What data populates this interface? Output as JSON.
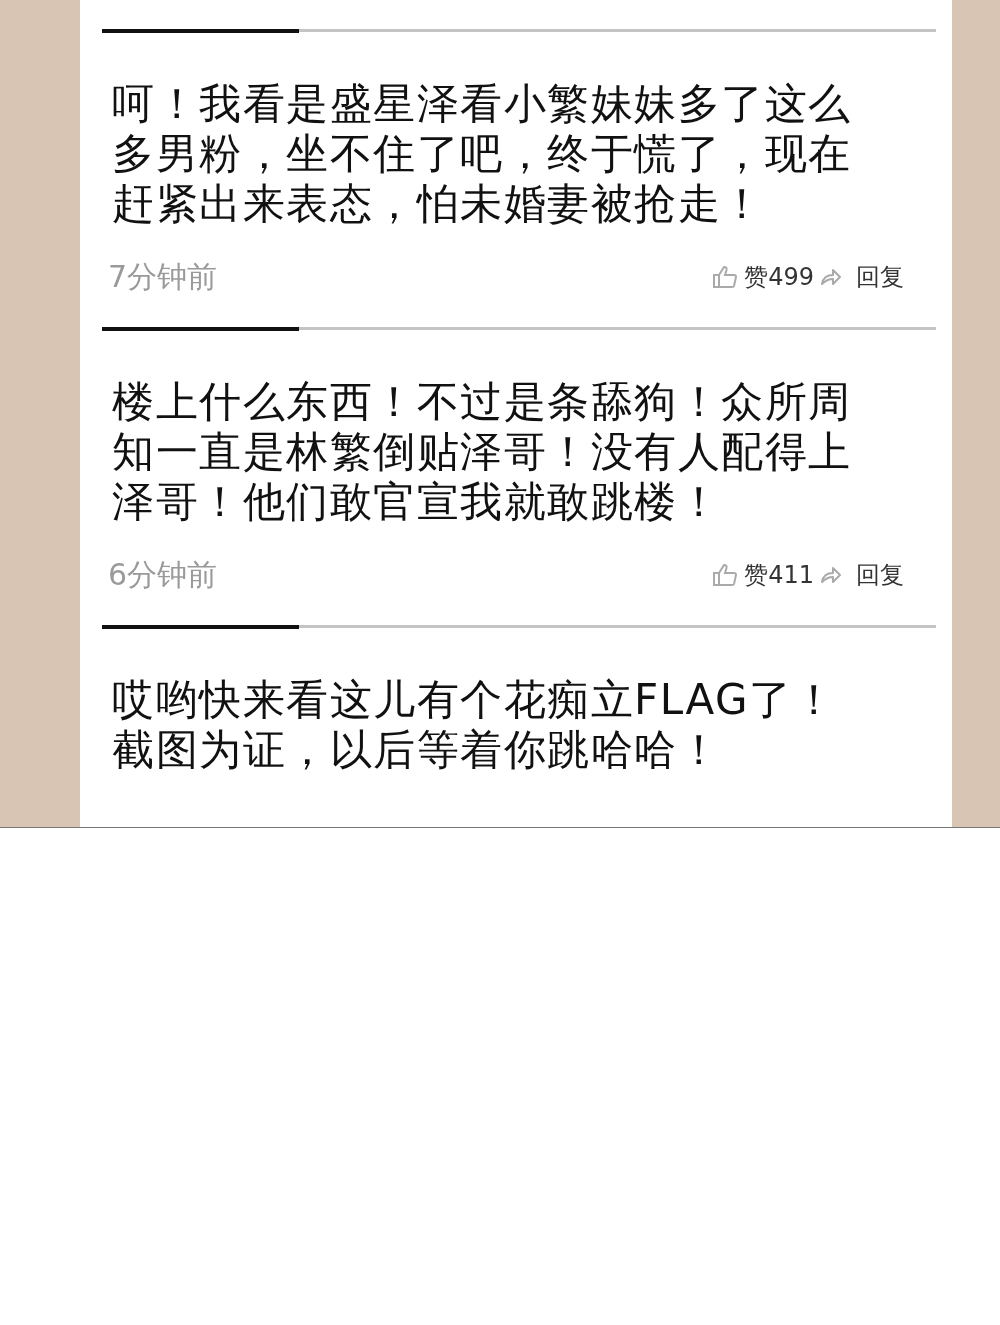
{
  "comments": [
    {
      "lines": [
        "呵！我看是盛星泽看小繁妹妹多了这么",
        "多男粉，坐不住了吧，终于慌了，现在",
        "赶紧出来表态，怕未婚妻被抢走！"
      ],
      "time": "7分钟前",
      "like_label": "赞499",
      "reply_label": "回复"
    },
    {
      "lines": [
        "楼上什么东西！不过是条舔狗！众所周",
        "知一直是林繁倒贴泽哥！没有人配得上",
        "泽哥！他们敢官宣我就敢跳楼！"
      ],
      "time": "6分钟前",
      "like_label": "赞411",
      "reply_label": "回复"
    },
    {
      "lines": [
        "哎哟快来看这儿有个花痴立FLAG了！",
        "截图为证，以后等着你跳哈哈！"
      ]
    }
  ]
}
